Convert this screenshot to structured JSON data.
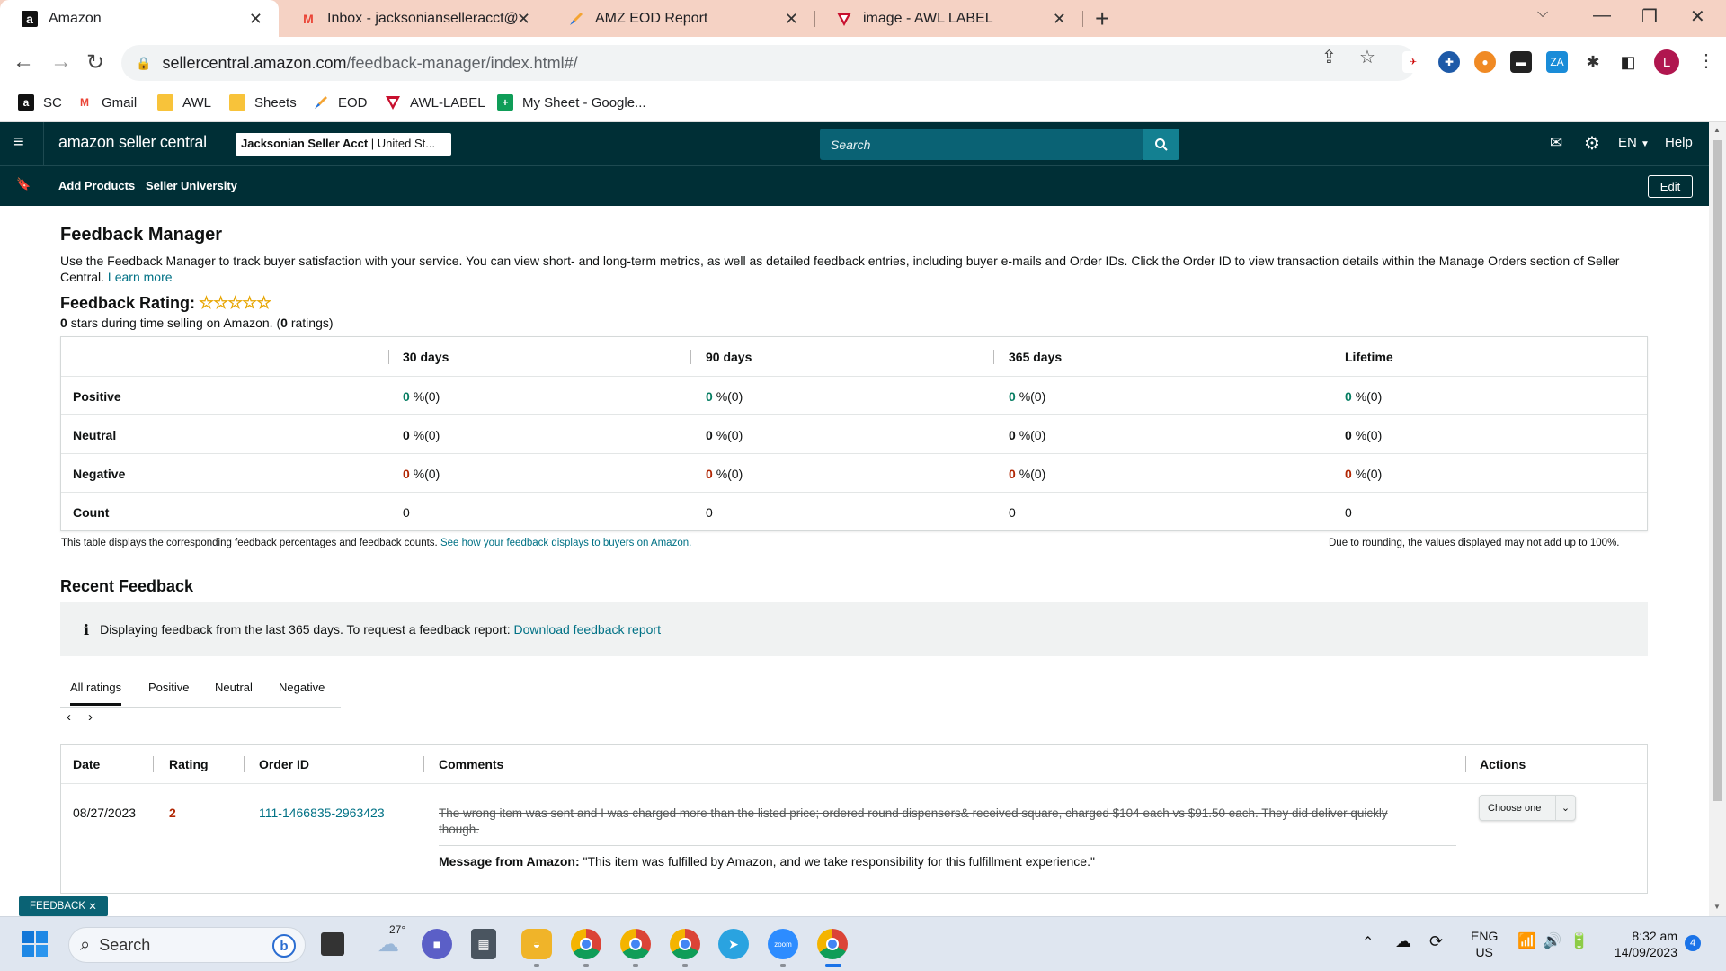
{
  "browser": {
    "tabs": [
      {
        "title": "Amazon",
        "icon": "a",
        "active": true
      },
      {
        "title": "Inbox - jacksonianselleracct@gmail.com",
        "icon": "M"
      },
      {
        "title": "AMZ EOD Report",
        "icon": "sheets"
      },
      {
        "title": "image - AWL LABEL",
        "icon": "awl"
      }
    ],
    "url_host": "sellercentral.amazon.com",
    "url_path": "/feedback-manager/index.html#/",
    "bookmarks": [
      "SC",
      "Gmail",
      "AWL",
      "Sheets",
      "EOD",
      "AWL-LABEL",
      "My Sheet - Google..."
    ],
    "profile_initial": "L"
  },
  "header": {
    "logo": "amazon seller central",
    "account_name": "Jacksonian Seller Acct",
    "account_region": "United St...",
    "search_placeholder": "Search",
    "lang": "EN",
    "help": "Help",
    "nav": [
      "Add Products",
      "Seller University"
    ],
    "edit": "Edit"
  },
  "page": {
    "title": "Feedback Manager",
    "description": "Use the Feedback Manager to track buyer satisfaction with your service. You can view short- and long-term metrics, as well as detailed feedback entries, including buyer e-mails and Order IDs. Click the Order ID to view transaction details within the Manage Orders section of Seller Central.",
    "learn_more": "Learn more",
    "rating_title": "Feedback Rating:",
    "stars_value": "0",
    "stars_text": "stars during time selling on Amazon. (",
    "ratings_count": "0",
    "ratings_suffix": "ratings)"
  },
  "metrics": {
    "columns": [
      "30 days",
      "90 days",
      "365 days",
      "Lifetime"
    ],
    "rows": [
      {
        "label": "Positive",
        "values": [
          "0",
          "0",
          "0",
          "0"
        ],
        "suffix": "%(0)",
        "tone": "green"
      },
      {
        "label": "Neutral",
        "values": [
          "0",
          "0",
          "0",
          "0"
        ],
        "suffix": "%(0)",
        "tone": "dark"
      },
      {
        "label": "Negative",
        "values": [
          "0",
          "0",
          "0",
          "0"
        ],
        "suffix": "%(0)",
        "tone": "red"
      },
      {
        "label": "Count",
        "values": [
          "0",
          "0",
          "0",
          "0"
        ],
        "suffix": "",
        "tone": "plain"
      }
    ],
    "footnote": "This table displays the corresponding feedback percentages and feedback counts.",
    "footnote_link": "See how your feedback displays to buyers on Amazon.",
    "rounding_note": "Due to rounding, the values displayed may not add up to 100%."
  },
  "recent": {
    "title": "Recent Feedback",
    "info": "Displaying feedback from the last 365 days. To request a feedback report:",
    "info_link": "Download feedback report",
    "tabs": [
      "All ratings",
      "Positive",
      "Neutral",
      "Negative"
    ],
    "columns": [
      "Date",
      "Rating",
      "Order ID",
      "Comments",
      "Actions"
    ],
    "entry": {
      "date": "08/27/2023",
      "rating": "2",
      "order_id": "111-1466835-2963423",
      "comment": "The wrong item was sent and I was charged more than the listed price; ordered round dispensers& received square, charged $104 each vs $91.50 each. They did deliver quickly though.",
      "amazon_label": "Message from Amazon:",
      "amazon_message": "\"This item was fulfilled by Amazon, and we take responsibility for this fulfillment experience.\"",
      "action": "Choose one"
    },
    "tag": "FEEDBACK"
  },
  "taskbar": {
    "search": "Search",
    "weather": "27°",
    "lang_top": "ENG",
    "lang_bottom": "US",
    "time": "8:32 am",
    "date": "14/09/2023",
    "notifications": "4"
  }
}
